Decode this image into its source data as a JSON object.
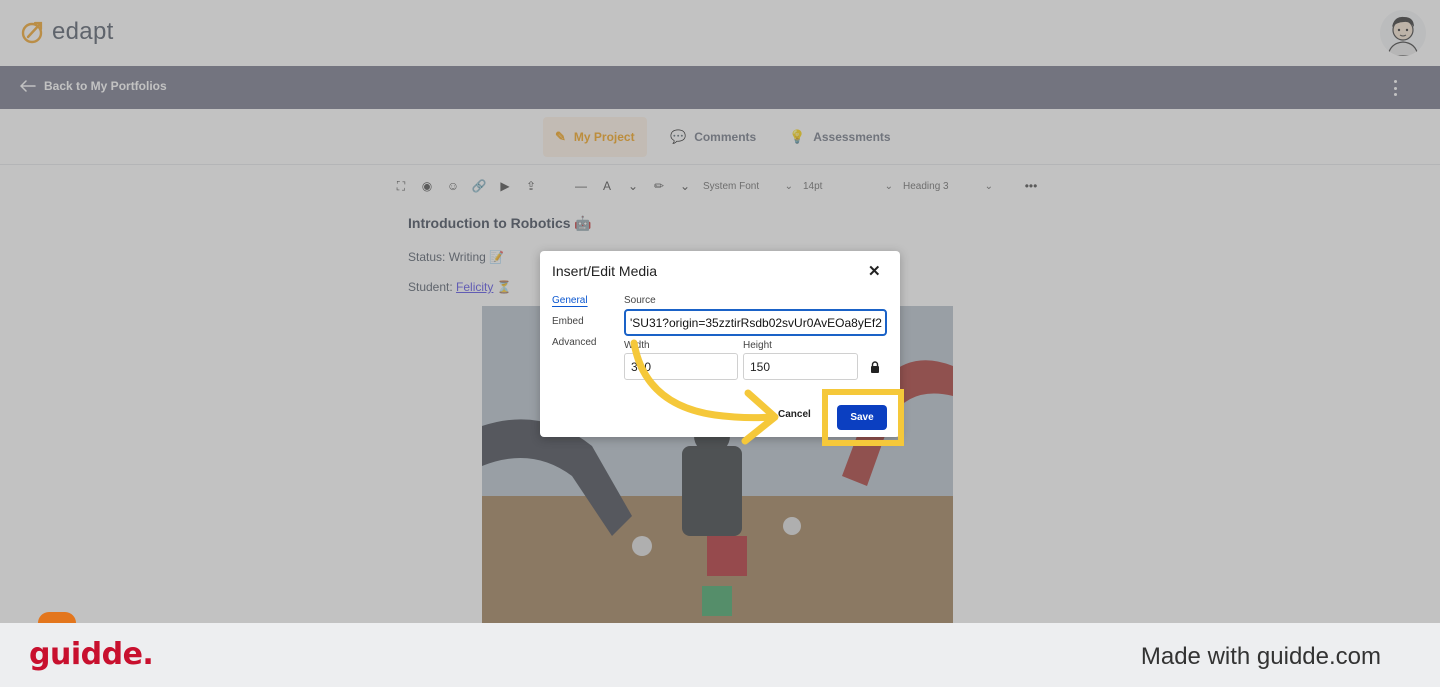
{
  "app": {
    "logo_text": "edapt"
  },
  "back_bar": {
    "back_label": "Back to My Portfolios"
  },
  "tabs": [
    {
      "label": "My Project",
      "icon": "pencil-icon",
      "active": true
    },
    {
      "label": "Comments",
      "icon": "comment-icon",
      "active": false
    },
    {
      "label": "Assessments",
      "icon": "lightbulb-icon",
      "active": false
    }
  ],
  "toolbar": {
    "font_family": "System Font",
    "font_size": "14pt",
    "block_format": "Heading 3"
  },
  "document": {
    "title": "Introduction to Robotics 🤖",
    "status": "Status: Writing 📝",
    "student_prefix": "Student: ",
    "student_name": "Felicity",
    "student_suffix": " ⏳"
  },
  "dialog": {
    "title": "Insert/Edit Media",
    "nav": [
      "General",
      "Embed",
      "Advanced"
    ],
    "source_label": "Source",
    "source_value": "'SU31?origin=35zztirRsdb02svUr0AvEOa8yEf2",
    "width_label": "Width",
    "width_value": "300",
    "height_label": "Height",
    "height_value": "150",
    "cancel_label": "Cancel",
    "save_label": "Save"
  },
  "footer": {
    "brand": "guidde.",
    "made_with": "Made with guidde.com"
  },
  "colors": {
    "accent": "#0b3fc1",
    "highlight": "#f5c83a",
    "brand_red": "#c8102e",
    "back_bar": "#6f7286"
  }
}
